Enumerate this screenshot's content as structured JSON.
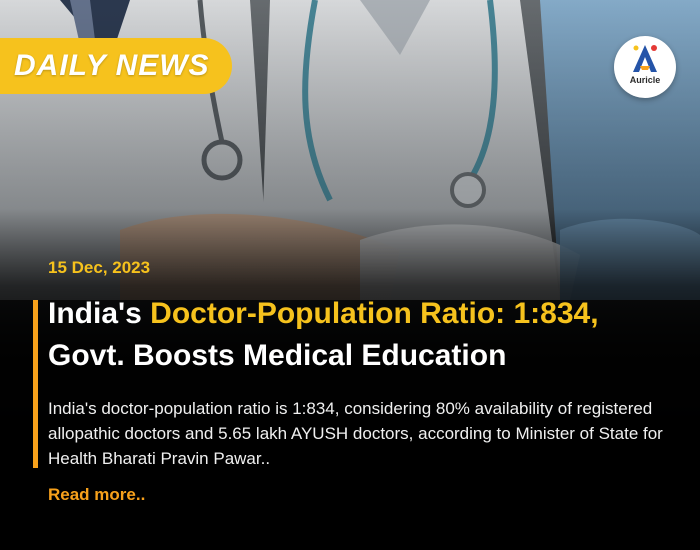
{
  "badge": {
    "label": "DAILY NEWS"
  },
  "logo": {
    "label": "Auricle"
  },
  "article": {
    "date": "15 Dec, 2023",
    "title_prefix": "India's ",
    "title_highlight": "Doctor-Population Ratio: 1:834,",
    "title_line2": "Govt. Boosts Medical Education",
    "description": "India's doctor-population ratio is 1:834, considering 80% availability of registered allopathic doctors and 5.65 lakh AYUSH doctors, according to Minister of State for Health Bharati Pravin Pawar..",
    "read_more": "Read more.."
  },
  "colors": {
    "badge": "#f6c21d",
    "highlight": "#f6c21d",
    "accent": "#f7a11b",
    "background": "#000000",
    "text": "#ffffff"
  },
  "icons": [
    "auricle-logo-icon",
    "doctors-photo"
  ]
}
